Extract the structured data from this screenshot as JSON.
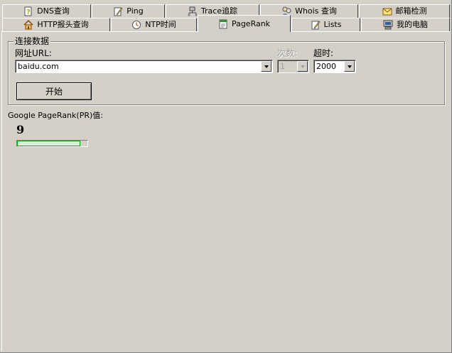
{
  "tabs": {
    "back_row": [
      {
        "label": "DNS查询",
        "icon": "dns-question-icon"
      },
      {
        "label": "Ping",
        "icon": "ping-pen-icon"
      },
      {
        "label": "Trace追踪",
        "icon": "trace-network-icon"
      },
      {
        "label": "Whois 查询",
        "icon": "whois-people-icon"
      },
      {
        "label": "邮箱检测",
        "icon": "mail-envelope-icon"
      }
    ],
    "front_row": [
      {
        "label": "HTTP报头查询",
        "icon": "http-house-icon"
      },
      {
        "label": "NTP时间",
        "icon": "ntp-clock-icon"
      },
      {
        "label": "PageRank",
        "icon": "pagerank-page-icon",
        "active": true
      },
      {
        "label": "Lists",
        "icon": "lists-pen-icon"
      },
      {
        "label": "我的电脑",
        "icon": "my-computer-icon"
      }
    ]
  },
  "connection": {
    "group_title": "连接数据",
    "url_label": "网址URL:",
    "url_value": "baidu.com",
    "count_label": "次数:",
    "count_value": "1",
    "timeout_label": "超时:",
    "timeout_value": "2000",
    "start_button": "开始"
  },
  "result": {
    "label": "Google PageRank(PR)值:",
    "value": "9",
    "pr_fraction": 0.9
  },
  "colors": {
    "background": "#d4d0c8",
    "progress_border": "#14a014",
    "progress_fill": "#d8f0d8"
  }
}
